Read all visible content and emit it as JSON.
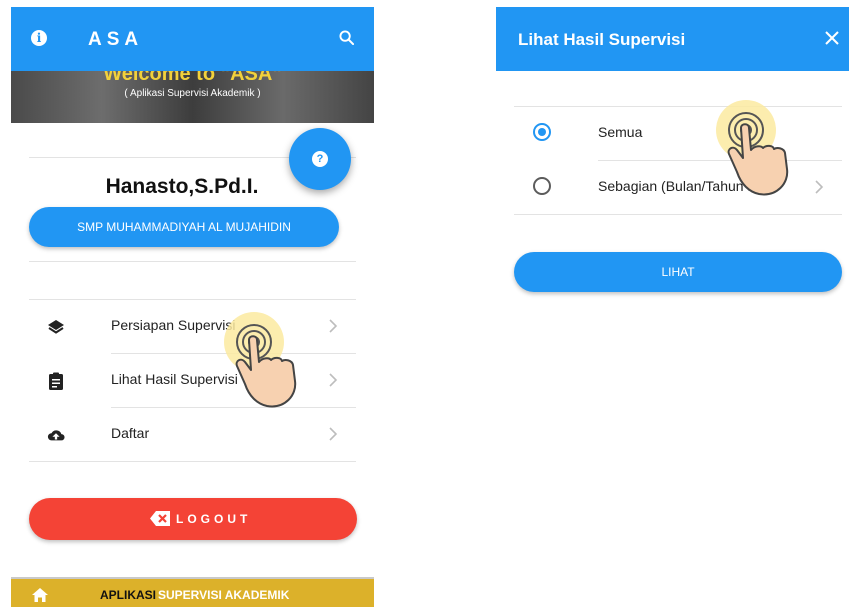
{
  "left_screen": {
    "appbar": {
      "title": "ASA",
      "info_icon": "info-icon",
      "search_icon": "search-icon"
    },
    "banner": {
      "welcome_text": "Welcome to \"ASA\"",
      "subtitle": "( Aplikasi Supervisi Akademik )"
    },
    "help_fab_icon": "help-icon",
    "user_name": "Hanasto,S.Pd.I.",
    "school_button": "SMP MUHAMMADIYAH AL MUJAHIDIN",
    "menu": [
      {
        "label": "Persiapan Supervisi",
        "icon": "layers-icon"
      },
      {
        "label": "Lihat Hasil Supervisi",
        "icon": "clipboard-icon"
      },
      {
        "label": "Daftar",
        "icon": "cloud-upload-icon"
      }
    ],
    "logout_label": "LOGOUT",
    "bottom_bar": {
      "part1": "APLIKASI",
      "part2": "SUPERVISI AKADEMIK",
      "icon": "home-icon"
    }
  },
  "right_screen": {
    "appbar": {
      "title": "Lihat Hasil Supervisi",
      "close_icon": "close-icon"
    },
    "options": [
      {
        "label": "Semua",
        "selected": true
      },
      {
        "label": "Sebagian (Bulan/Tahun Pela",
        "selected": false
      }
    ],
    "button_label": "LIHAT"
  },
  "colors": {
    "primary": "#2196f3",
    "logout": "#f44336",
    "bottom_bar": "#dcb12a",
    "banner_text": "#f2d13b"
  }
}
